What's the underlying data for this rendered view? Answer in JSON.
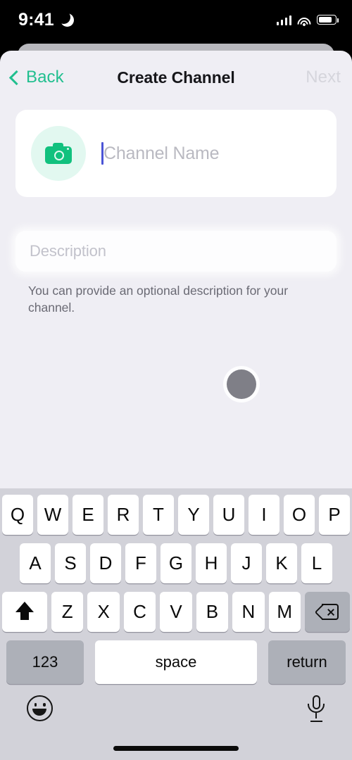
{
  "status_bar": {
    "time": "9:41",
    "dnd_icon": "moon-icon",
    "signal_icon": "cellular-signal-icon",
    "wifi_icon": "wifi-icon",
    "battery_icon": "battery-icon"
  },
  "navbar": {
    "back_label": "Back",
    "back_icon": "chevron-left-icon",
    "title": "Create Channel",
    "next_label": "Next",
    "next_enabled": false,
    "accent_color": "#21bf8f",
    "disabled_color": "#d5d5dc"
  },
  "form": {
    "avatar": {
      "icon": "camera-icon",
      "icon_color": "#11c17e",
      "background_color": "#e2f8f0"
    },
    "channel_name": {
      "value": "",
      "placeholder": "Channel Name",
      "focused": true,
      "caret_color": "#4b54d6"
    },
    "description": {
      "value": "",
      "placeholder": "Description"
    },
    "helper_text": "You can provide an optional description for your channel."
  },
  "touch_indicator": {
    "visible": true,
    "color": "#7f7f87"
  },
  "keyboard": {
    "layout": "qwerty",
    "background_color": "#d2d2d9",
    "rows": [
      [
        "Q",
        "W",
        "E",
        "R",
        "T",
        "Y",
        "U",
        "I",
        "O",
        "P"
      ],
      [
        "A",
        "S",
        "D",
        "F",
        "G",
        "H",
        "J",
        "K",
        "L"
      ],
      [
        "Z",
        "X",
        "C",
        "V",
        "B",
        "N",
        "M"
      ]
    ],
    "shift_icon": "shift-arrow-icon",
    "backspace_icon": "backspace-icon",
    "numbers_label": "123",
    "space_label": "space",
    "return_label": "return",
    "emoji_icon": "emoji-smiley-icon",
    "dictation_icon": "microphone-icon"
  },
  "home_indicator": "home-indicator"
}
